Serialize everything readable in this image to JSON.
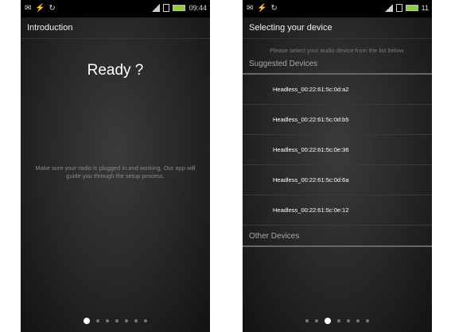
{
  "left": {
    "status": {
      "icons_left": "✉ ⚡ ↻",
      "time": "09:44"
    },
    "actionbar_title": "Introduction",
    "heading": "Ready ?",
    "body_text": "Make sure your radio is plugged in and working. Our app will guide you through the setup process."
  },
  "right": {
    "status": {
      "icons_left": "✉ ⚡ ↻",
      "time": "11"
    },
    "actionbar_title": "Selecting your device",
    "instructions": "Please select your audio device from the list below.",
    "suggested_header": "Suggested Devices",
    "devices": [
      "Headless_00:22:61:5c:0d:a2",
      "Headless_00:22:61:5c:0d:b5",
      "Headless_00:22:61:5c:0e:36",
      "Headless_00:22:61:5c:0d:6a",
      "Headless_00:22:61:5c:0e:12"
    ],
    "other_header": "Other Devices"
  },
  "colors": {
    "battery": "#8ecf3a",
    "background": "#262626",
    "divider": "#666666"
  }
}
